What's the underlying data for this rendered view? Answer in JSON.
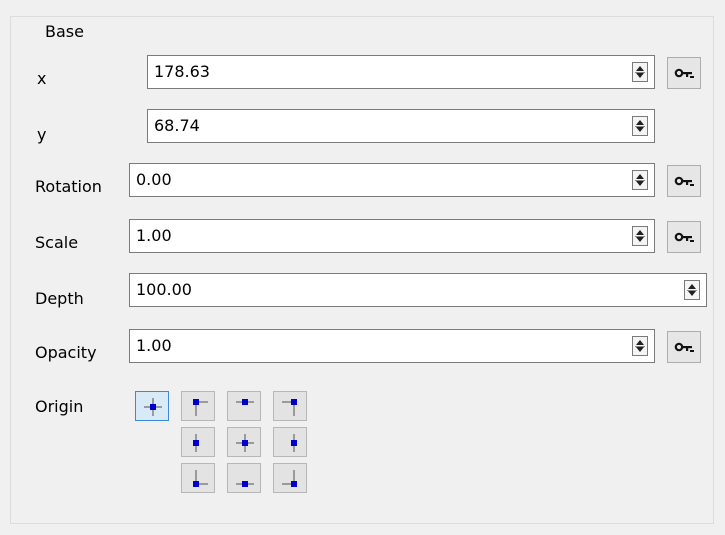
{
  "group": {
    "title": "Base"
  },
  "fields": {
    "x": {
      "label": "x",
      "value": "178.63"
    },
    "y": {
      "label": "y",
      "value": "68.74"
    },
    "rotation": {
      "label": "Rotation",
      "value": "0.00"
    },
    "scale": {
      "label": "Scale",
      "value": "1.00"
    },
    "depth": {
      "label": "Depth",
      "value": "100.00"
    },
    "opacity": {
      "label": "Opacity",
      "value": "1.00"
    }
  },
  "origin": {
    "label": "Origin",
    "selected": "center",
    "options": [
      "center",
      "top-left",
      "top-center",
      "top-right",
      "middle-left",
      "middle-center",
      "middle-right",
      "bottom-left",
      "bottom-center",
      "bottom-right"
    ]
  },
  "icons": {
    "keyframe": "key-icon",
    "spin": "spin-arrows-icon"
  },
  "colors": {
    "accent": "#3a8ad6",
    "origin_dot": "#0000cc"
  }
}
